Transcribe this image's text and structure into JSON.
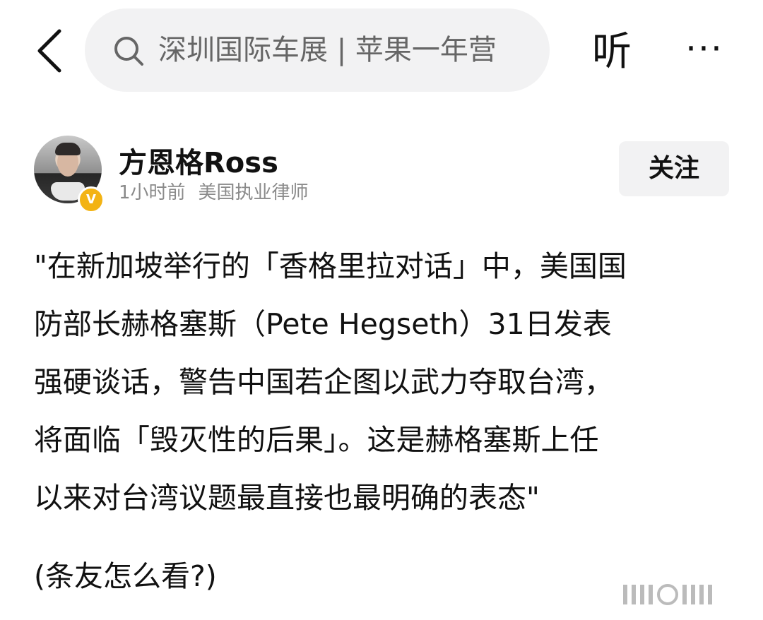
{
  "topbar": {
    "search_text": "深圳国际车展 | 苹果一年营",
    "listen_label": "听",
    "more_label": "···"
  },
  "author": {
    "name": "方恩格Ross",
    "time": "1小时前",
    "title": "美国执业律师",
    "follow_label": "关注"
  },
  "post": {
    "lines": [
      "\"在新加坡举行的「香格里拉对话」中，美国国",
      "防部长赫格塞斯（Pete Hegseth）31日发表",
      "强硬谈话，警告中国若企图以武力夺取台湾，",
      "将面临「毁灭性的后果」。这是赫格塞斯上任",
      "以来对台湾议题最直接也最明确的表态\""
    ],
    "question": "(条友怎么看?)"
  },
  "colors": {
    "search_bg": "#f2f2f3",
    "follow_bg": "#f2f2f3",
    "badge": "#f3b313"
  }
}
